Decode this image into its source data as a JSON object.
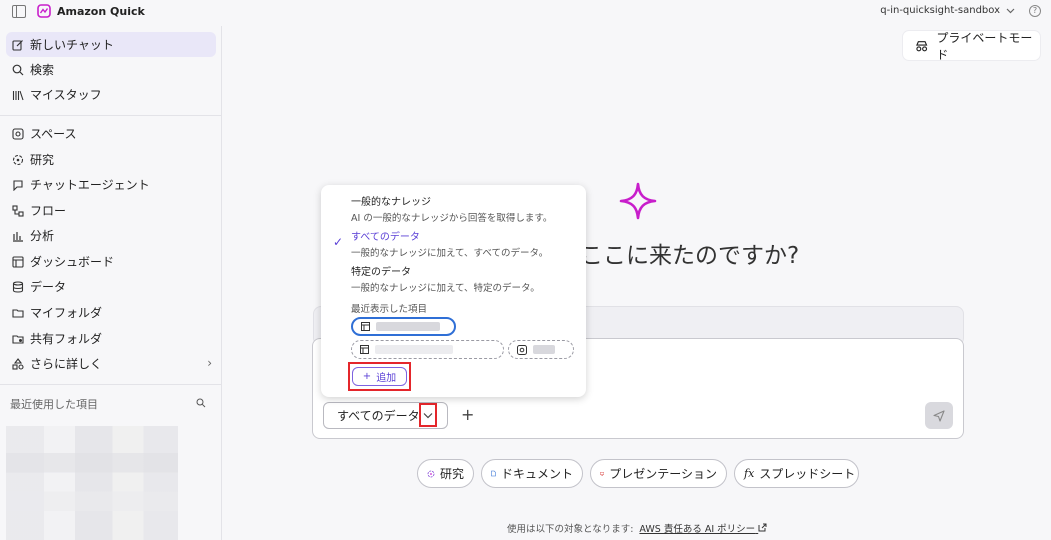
{
  "app": {
    "name": "Amazon Quick",
    "account": "q-in-quicksight-sandbox"
  },
  "sidebar": {
    "items": [
      {
        "label": "新しいチャット",
        "icon": "edit-icon"
      },
      {
        "label": "検索",
        "icon": "search-icon"
      },
      {
        "label": "マイスタッフ",
        "icon": "library-icon"
      },
      {
        "label": "スペース",
        "icon": "spaces-icon"
      },
      {
        "label": "研究",
        "icon": "research-icon"
      },
      {
        "label": "チャットエージェント",
        "icon": "chat-agent-icon"
      },
      {
        "label": "フロー",
        "icon": "flow-icon"
      },
      {
        "label": "分析",
        "icon": "analysis-icon"
      },
      {
        "label": "ダッシュボード",
        "icon": "dashboard-icon"
      },
      {
        "label": "データ",
        "icon": "database-icon"
      },
      {
        "label": "マイフォルダ",
        "icon": "folder-icon"
      },
      {
        "label": "共有フォルダ",
        "icon": "shared-folder-icon"
      },
      {
        "label": "さらに詳しく",
        "icon": "shapes-icon"
      }
    ],
    "recent_title": "最近使用した項目"
  },
  "main": {
    "private_mode": "プライベートモード",
    "headline": "ここに来たのですか?",
    "data_select": "すべてのデータ",
    "suggestions": [
      {
        "label": "研究",
        "icon": "research-icon"
      },
      {
        "label": "ドキュメント",
        "icon": "document-icon"
      },
      {
        "label": "プレゼンテーション",
        "icon": "presentation-icon"
      },
      {
        "label": "スプレッドシート",
        "icon": "spreadsheet-icon"
      }
    ],
    "footer_text": "使用は以下の対象となります:",
    "footer_link": "AWS 責任ある AI ポリシー"
  },
  "dropdown": {
    "options": [
      {
        "title": "一般的なナレッジ",
        "desc": "AI の一般的なナレッジから回答を取得します。",
        "selected": false
      },
      {
        "title": "すべてのデータ",
        "desc": "一般的なナレッジに加えて、すべてのデータ。",
        "selected": true
      },
      {
        "title": "特定のデータ",
        "desc": "一般的なナレッジに加えて、特定のデータ。",
        "selected": false
      }
    ],
    "recent_label": "最近表示した項目",
    "add_label": "追加"
  },
  "colors": {
    "accent": "#5a3fd6",
    "highlight_box": "#e4262b",
    "brand": "#c81ecb"
  }
}
